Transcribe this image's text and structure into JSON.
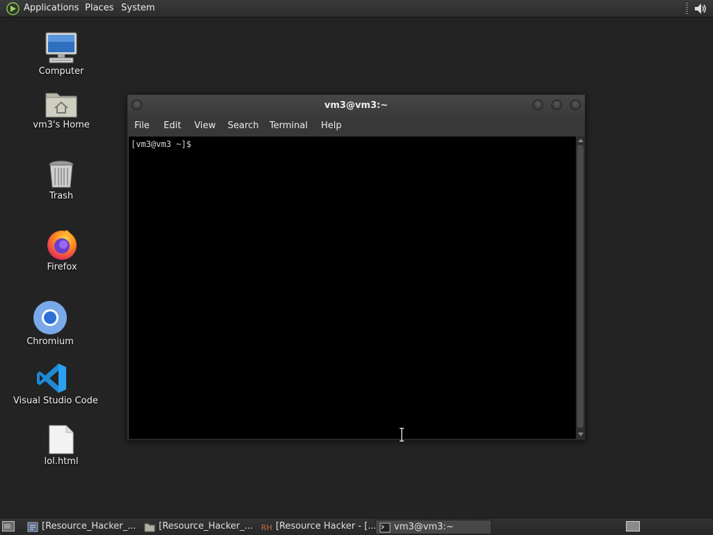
{
  "top_panel": {
    "menus": [
      "Applications",
      "Places",
      "System"
    ]
  },
  "desktop": {
    "icons": [
      {
        "label": "Computer",
        "icon": "computer-icon"
      },
      {
        "label": "vm3's Home",
        "icon": "home-folder-icon"
      },
      {
        "label": "Trash",
        "icon": "trash-icon"
      },
      {
        "label": "Firefox",
        "icon": "firefox-icon"
      },
      {
        "label": "Chromium",
        "icon": "chromium-icon"
      },
      {
        "label": "Visual Studio Code",
        "icon": "vscode-icon"
      },
      {
        "label": "lol.html",
        "icon": "html-file-icon"
      }
    ]
  },
  "terminal": {
    "title": "vm3@vm3:~",
    "menus": [
      "File",
      "Edit",
      "View",
      "Search",
      "Terminal",
      "Help"
    ],
    "prompt": "[vm3@vm3 ~]$"
  },
  "taskbar": {
    "tasks": [
      {
        "label": "[Resource_Hacker_...",
        "icon": "editor-icon",
        "active": false
      },
      {
        "label": "[Resource_Hacker_...",
        "icon": "folder-icon",
        "active": false
      },
      {
        "label": "[Resource Hacker - [...",
        "icon": "resource-hacker-icon",
        "active": false
      },
      {
        "label": "vm3@vm3:~",
        "icon": "terminal-icon",
        "active": true
      }
    ]
  },
  "colors": {
    "desktop_bg": "#232323",
    "terminal_bg": "#000000",
    "panel_bg": "#2c2c2c"
  }
}
